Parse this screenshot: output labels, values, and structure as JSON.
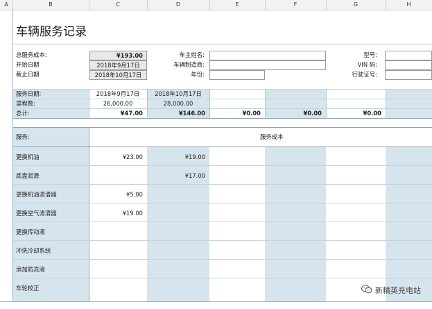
{
  "columns": [
    "A",
    "B",
    "C",
    "D",
    "E",
    "F",
    "G",
    "H"
  ],
  "title": "车辆服务记录",
  "summary": {
    "total_cost_label": "总服务成本:",
    "total_cost_value": "¥193.00",
    "start_date_label": "开始日期",
    "start_date_value": "2018年9月17日",
    "end_date_label": "截止日期",
    "end_date_value": "2018年10月17日",
    "owner_label": "车主姓名:",
    "make_label": "车辆制造商:",
    "year_label": "年份:",
    "model_label": "型号:",
    "vin_label": "VIN 码:",
    "license_label": "行驶证号:"
  },
  "service_block": {
    "date_label": "服务日期:",
    "mileage_label": "里程数:",
    "total_label": "总计:",
    "dates": [
      "2018年9月17日",
      "2018年10月17日"
    ],
    "mileages": [
      "26,000.00",
      "28,000.00"
    ],
    "totals": [
      "¥47.00",
      "¥146.00",
      "¥0.00",
      "¥0.00",
      "¥0.00"
    ]
  },
  "table": {
    "service_header": "服务:",
    "cost_header": "服务成本",
    "rows": [
      {
        "name": "更换机油",
        "c1": "¥23.00",
        "c2": "¥19.00"
      },
      {
        "name": "底盘润滑",
        "c1": "",
        "c2": "¥17.00"
      },
      {
        "name": "更换机油滤清器",
        "c1": "¥5.00",
        "c2": ""
      },
      {
        "name": "更换空气滤清器",
        "c1": "¥19.00",
        "c2": ""
      },
      {
        "name": "更换传动液",
        "c1": "",
        "c2": ""
      },
      {
        "name": "冲洗冷却系统",
        "c1": "",
        "c2": ""
      },
      {
        "name": "添加防冻液",
        "c1": "",
        "c2": ""
      },
      {
        "name": "车轮校正",
        "c1": "",
        "c2": ""
      }
    ]
  },
  "watermark": "新精英充电站",
  "watermark_icon": "wechat-icon",
  "colors": {
    "blue_band": "#d6e4ee",
    "grid": "#b8c6d0"
  }
}
